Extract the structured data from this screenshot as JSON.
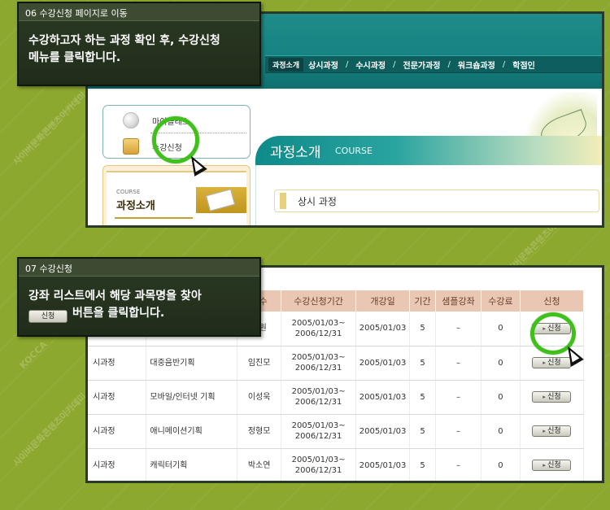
{
  "watermark": [
    "KOCCA",
    "사이버문화콘텐츠아카데미"
  ],
  "step06": {
    "header": "06 수강신청 페이지로 이동",
    "instruction_line1": "수강하고자 하는 과정 확인 후, 수강신청",
    "instruction_line2": "메뉴를 클릭합니다."
  },
  "site": {
    "nav_badge": "과정소개",
    "nav_items": [
      "상시과정",
      "수시과정",
      "전문가과정",
      "워크숍과정",
      "학점인"
    ],
    "myclass_label": "마이클래스",
    "apply_menu_label": "수강신청",
    "tab_title": "과정소개",
    "tab_subtitle": "COURSE",
    "course_small": "COURSE",
    "course_title": "과정소개",
    "section_label": "상시 과정"
  },
  "step07": {
    "header": "07 수강신청",
    "instruction_line1": "강좌 리스트에서 해당 과목명을 찾아",
    "instruction_btn": "신청",
    "instruction_line2": "버튼을 클릭합니다."
  },
  "table": {
    "columns": [
      "교수",
      "수강신청기간",
      "개강일",
      "기간",
      "샘플강좌",
      "수강료",
      "신청"
    ],
    "apply_label": "신청",
    "rows": [
      {
        "type": "",
        "course": "",
        "prof": "해원",
        "period_start": "2005/01/03~",
        "period_end": "2006/12/31",
        "start": "2005/01/03",
        "days": "5",
        "sample": "–",
        "fee": "0"
      },
      {
        "type": "시과정",
        "course": "대중음반기획",
        "prof": "임진모",
        "period_start": "2005/01/03~",
        "period_end": "2006/12/31",
        "start": "2005/01/03",
        "days": "5",
        "sample": "–",
        "fee": "0"
      },
      {
        "type": "시과정",
        "course": "모바일/인터넷 기획",
        "prof": "이성욱",
        "period_start": "2005/01/03~",
        "period_end": "2006/12/31",
        "start": "2005/01/03",
        "days": "5",
        "sample": "–",
        "fee": "0"
      },
      {
        "type": "시과정",
        "course": "애니메이션기획",
        "prof": "정형모",
        "period_start": "2005/01/03~",
        "period_end": "2006/12/31",
        "start": "2005/01/03",
        "days": "5",
        "sample": "–",
        "fee": "0"
      },
      {
        "type": "시과정",
        "course": "캐릭터기획",
        "prof": "박소연",
        "period_start": "2005/01/03~",
        "period_end": "2006/12/31",
        "start": "2005/01/03",
        "days": "5",
        "sample": "–",
        "fee": "0"
      }
    ]
  }
}
